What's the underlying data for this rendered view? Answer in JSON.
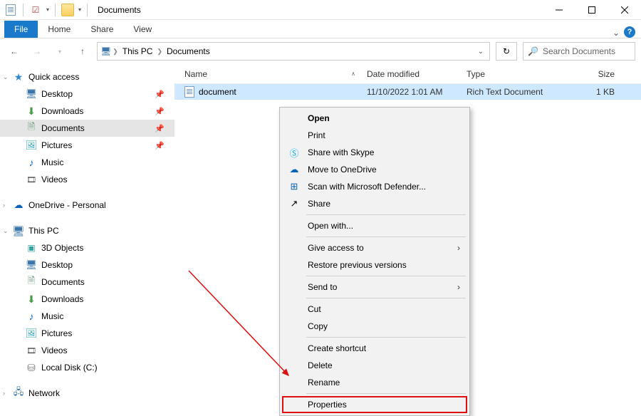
{
  "titlebar": {
    "title": "Documents"
  },
  "ribbon": {
    "file": "File",
    "home": "Home",
    "share": "Share",
    "view": "View"
  },
  "address": {
    "pc": "This PC",
    "current": "Documents"
  },
  "search": {
    "placeholder": "Search Documents"
  },
  "sidebar": {
    "quick": "Quick access",
    "desktop": "Desktop",
    "downloads": "Downloads",
    "documents": "Documents",
    "pictures": "Pictures",
    "music": "Music",
    "videos": "Videos",
    "onedrive": "OneDrive - Personal",
    "thispc": "This PC",
    "objects3d": "3D Objects",
    "desktop2": "Desktop",
    "documents2": "Documents",
    "downloads2": "Downloads",
    "music2": "Music",
    "pictures2": "Pictures",
    "videos2": "Videos",
    "cdrive": "Local Disk (C:)",
    "network": "Network"
  },
  "columns": {
    "name": "Name",
    "date": "Date modified",
    "type": "Type",
    "size": "Size"
  },
  "rows": [
    {
      "name": "document",
      "date": "11/10/2022 1:01 AM",
      "type": "Rich Text Document",
      "size": "1 KB"
    }
  ],
  "ctx": {
    "open": "Open",
    "print": "Print",
    "skype": "Share with Skype",
    "onedrive": "Move to OneDrive",
    "defender": "Scan with Microsoft Defender...",
    "share": "Share",
    "openwith": "Open with...",
    "giveaccess": "Give access to",
    "restore": "Restore previous versions",
    "sendto": "Send to",
    "cut": "Cut",
    "copy": "Copy",
    "shortcut": "Create shortcut",
    "delete": "Delete",
    "rename": "Rename",
    "properties": "Properties"
  }
}
